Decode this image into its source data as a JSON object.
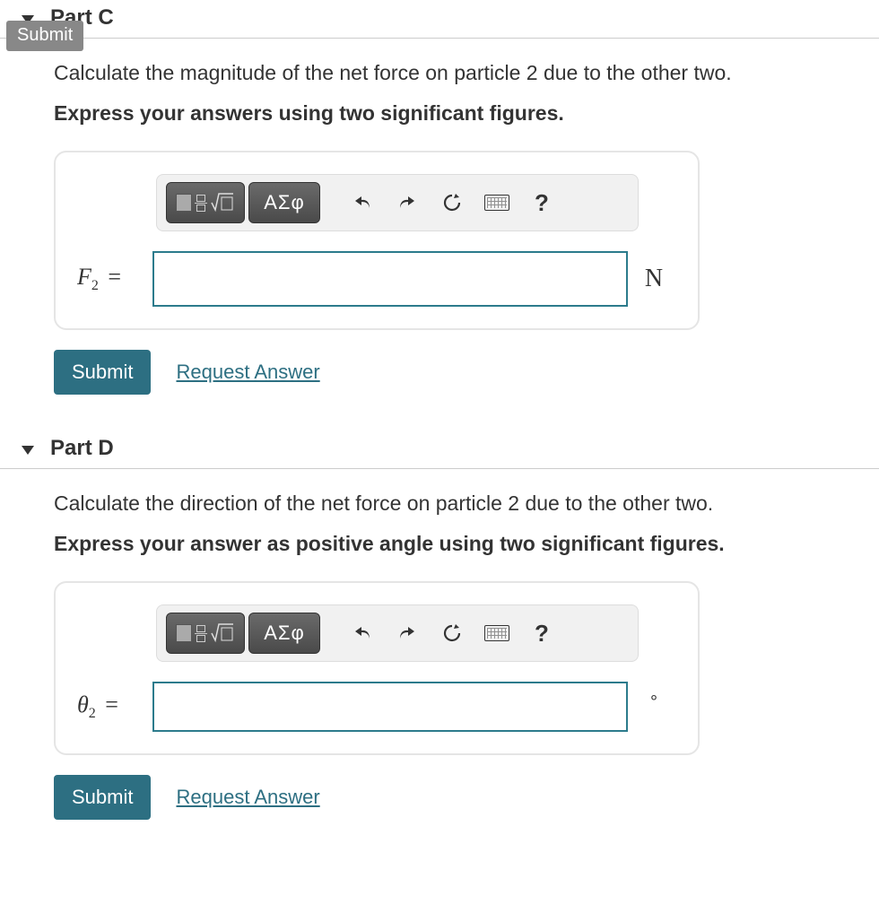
{
  "floatSubmit": "Submit",
  "toolbar": {
    "greek": "ΑΣφ",
    "help": "?"
  },
  "actions": {
    "submit": "Submit",
    "request": "Request Answer"
  },
  "parts": {
    "c": {
      "title": "Part C",
      "prompt": "Calculate the magnitude of the net force on particle 2 due to the other two.",
      "hint": "Express your answers using two significant figures.",
      "var_html": "F",
      "sub": "2",
      "eq": " = ",
      "unit": "N"
    },
    "d": {
      "title": "Part D",
      "prompt": "Calculate the direction of the net force on particle 2 due to the other two.",
      "hint": "Express your answer as positive angle using two significant figures.",
      "var_html": "θ",
      "sub": "2",
      "eq": " = ",
      "unit": "∘"
    }
  }
}
